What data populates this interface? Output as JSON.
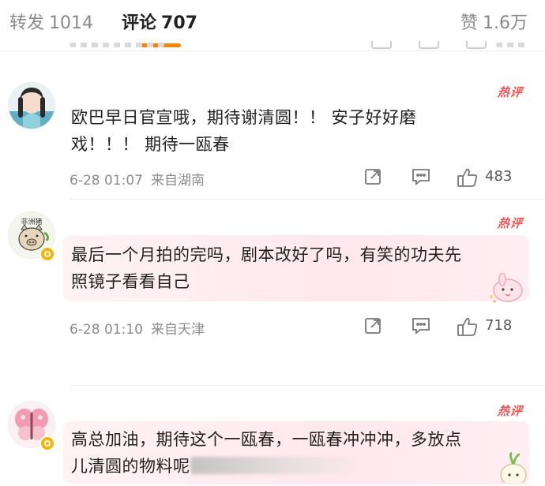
{
  "tabs": {
    "repost_label": "转发",
    "repost_count": "1014",
    "comment_label": "评论",
    "comment_count": "707",
    "like_label": "赞",
    "like_count": "1.6万"
  },
  "colors": {
    "accent": "#ff8200",
    "hot": "#ff4d4d",
    "verified": "#f7b500",
    "bubble_pink": "#ffe8ee"
  },
  "comments": [
    {
      "avatar": "avatar-woman-icon",
      "verified": false,
      "hot_label": "热评",
      "text_line1": "欧巴早日官宣哦，期待谢清圆！！ 安子好好磨",
      "text_line2": "戏！！！ 期待一瓯春",
      "date": "6-28 01:07",
      "location": "来自湖南",
      "likes": "483"
    },
    {
      "avatar": "avatar-pig-icon",
      "avatar_text": "非洲猪",
      "verified": true,
      "hot_label": "热评",
      "text_line1": "最后一个月拍的完吗，剧本改好了吗，有笑的功夫先",
      "text_line2": "照镜子看看自己",
      "date": "6-28 01:10",
      "location": "来自天津",
      "likes": "718"
    },
    {
      "avatar": "avatar-butterfly-icon",
      "verified": true,
      "hot_label": "热评",
      "text_line1": "高总加油，期待这个一瓯春，一瓯春冲冲冲，多放点",
      "text_line2": "儿清圆的物料呢"
    }
  ]
}
